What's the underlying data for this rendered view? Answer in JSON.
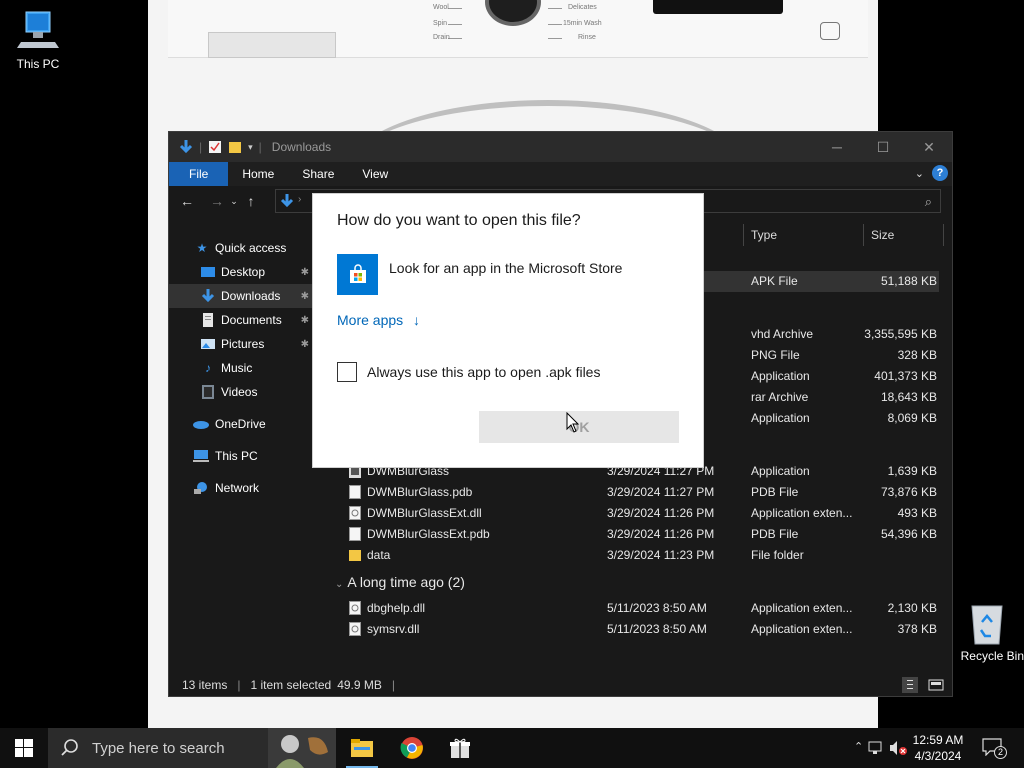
{
  "desktop": {
    "icons": [
      {
        "label": "This PC"
      },
      {
        "label": "Recycle Bin"
      }
    ]
  },
  "wallpaper": {
    "labels": [
      "Wool",
      "Spin",
      "Drain",
      "Delicates",
      "15min Wash",
      "Rinse"
    ]
  },
  "explorer": {
    "title": "Downloads",
    "tabs": [
      "File",
      "Home",
      "Share",
      "View"
    ],
    "help_label": "?",
    "sidebar": [
      {
        "label": "Quick access"
      },
      {
        "label": "Desktop"
      },
      {
        "label": "Downloads"
      },
      {
        "label": "Documents"
      },
      {
        "label": "Pictures"
      },
      {
        "label": "Music"
      },
      {
        "label": "Videos"
      },
      {
        "label": "OneDrive"
      },
      {
        "label": "This PC"
      },
      {
        "label": "Network"
      }
    ],
    "columns": {
      "type": "Type",
      "size": "Size"
    },
    "rows_top": [
      {
        "type": "APK File",
        "size": "51,188 KB"
      },
      {
        "type": "vhd Archive",
        "size": "3,355,595 KB"
      },
      {
        "type": "PNG File",
        "size": "328 KB"
      },
      {
        "type": "Application",
        "size": "401,373 KB"
      },
      {
        "type": "rar Archive",
        "size": "18,643 KB"
      },
      {
        "type": "Application",
        "size": "8,069 KB"
      }
    ],
    "rows": [
      {
        "name": "DWMBlurGlass",
        "date": "3/29/2024 11:27 PM",
        "type": "Application",
        "size": "1,639 KB"
      },
      {
        "name": "DWMBlurGlass.pdb",
        "date": "3/29/2024 11:27 PM",
        "type": "PDB File",
        "size": "73,876 KB"
      },
      {
        "name": "DWMBlurGlassExt.dll",
        "date": "3/29/2024 11:26 PM",
        "type": "Application exten...",
        "size": "493 KB"
      },
      {
        "name": "DWMBlurGlassExt.pdb",
        "date": "3/29/2024 11:26 PM",
        "type": "PDB File",
        "size": "54,396 KB"
      },
      {
        "name": "data",
        "date": "3/29/2024 11:23 PM",
        "type": "File folder",
        "size": ""
      }
    ],
    "group_long_ago": "A long time ago (2)",
    "rows_old": [
      {
        "name": "dbghelp.dll",
        "date": "5/11/2023 8:50 AM",
        "type": "Application exten...",
        "size": "2,130 KB"
      },
      {
        "name": "symsrv.dll",
        "date": "5/11/2023 8:50 AM",
        "type": "Application exten...",
        "size": "378 KB"
      }
    ],
    "status": {
      "items": "13 items",
      "selected": "1 item selected",
      "size": "49.9 MB"
    }
  },
  "dialog": {
    "title": "How do you want to open this file?",
    "store_option": "Look for an app in the Microsoft Store",
    "more_apps": "More apps",
    "more_apps_arrow": "↓",
    "checkbox_label": "Always use this app to open .apk files",
    "ok_label": "OK"
  },
  "taskbar": {
    "search_placeholder": "Type here to search",
    "time": "12:59 AM",
    "date": "4/3/2024",
    "notification_count": "2"
  }
}
